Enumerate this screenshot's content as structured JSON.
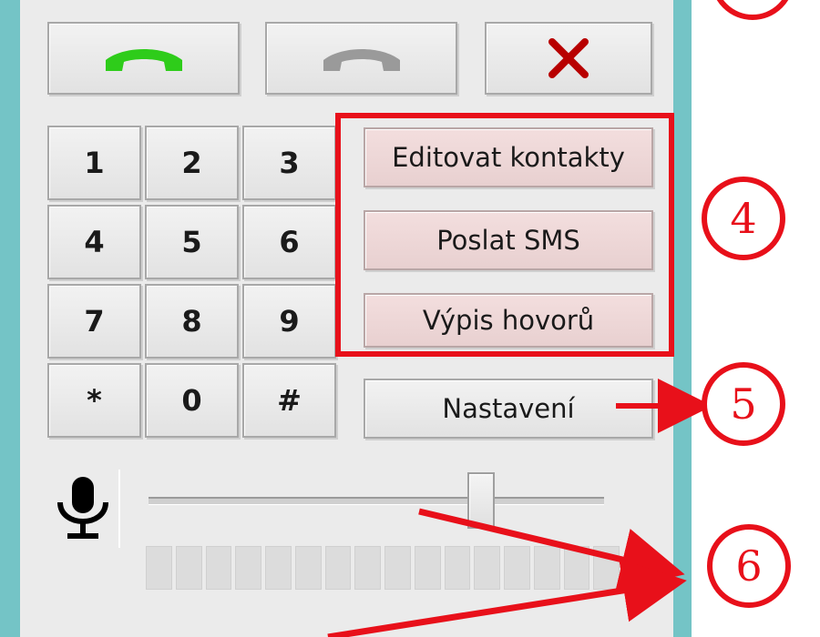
{
  "call_controls": {
    "answer_icon": "phone-green",
    "hangup_icon": "phone-grey",
    "close_icon": "red-x",
    "accent_green": "#2ecc1a",
    "accent_grey": "#9a9a9a",
    "accent_red": "#b80000"
  },
  "keypad": {
    "keys": [
      "1",
      "2",
      "3",
      "4",
      "5",
      "6",
      "7",
      "8",
      "9",
      "*",
      "0",
      "#"
    ]
  },
  "side_menu": {
    "edit_contacts": "Editovat kontakty",
    "send_sms": "Poslat SMS",
    "call_log": "Výpis hovorů",
    "settings": "Nastavení"
  },
  "audio": {
    "mic_icon": "microphone",
    "volume_fraction": 0.73,
    "level_segments_total": 16,
    "level_segments_lit": 0
  },
  "annotations": {
    "color": "#e8101a",
    "badges": [
      "4",
      "5",
      "6"
    ]
  }
}
